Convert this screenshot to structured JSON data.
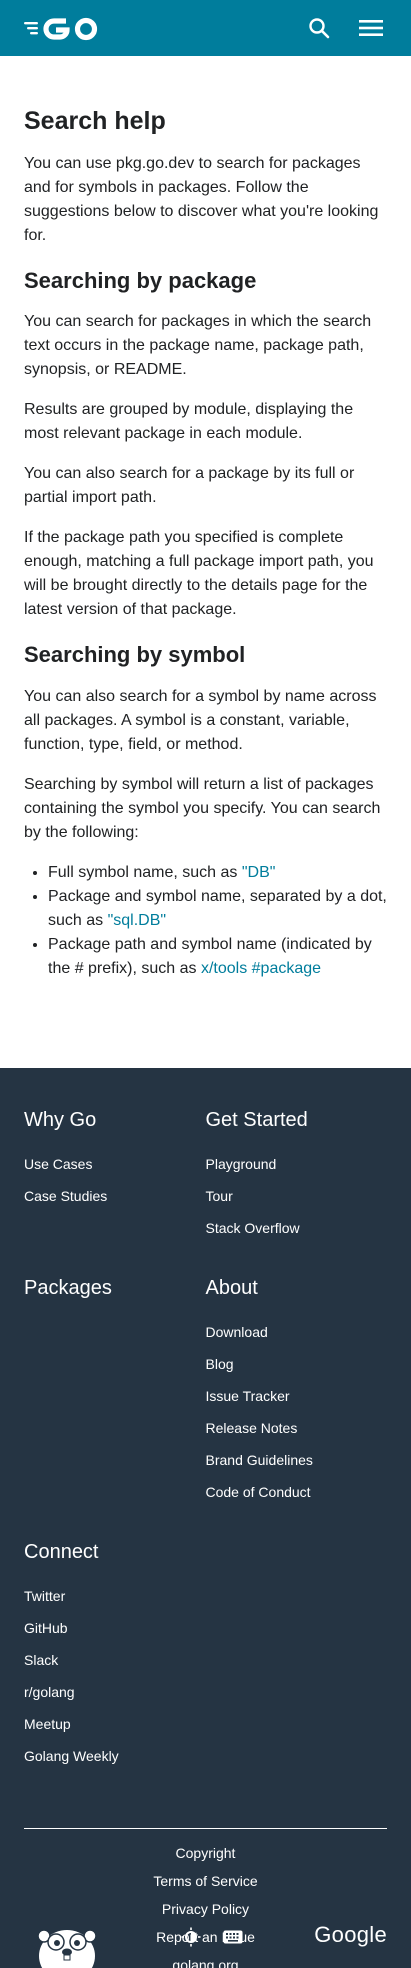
{
  "header": {
    "logo_alt": "GO",
    "icons": [
      "search-icon",
      "menu-icon"
    ]
  },
  "main": {
    "title": "Search help",
    "intro": "You can use pkg.go.dev to search for packages and for symbols in packages. Follow the suggestions below to discover what you're looking for.",
    "pkg_heading": "Searching by package",
    "pkg_p1": "You can search for packages in which the search text occurs in the package name, package path, synopsis, or README.",
    "pkg_p2": "Results are grouped by module, displaying the most relevant package in each module.",
    "pkg_p3": "You can also search for a package by its full or partial import path.",
    "pkg_p4": "If the package path you specified is complete enough, matching a full package import path, you will be brought directly to the details page for the latest version of that package.",
    "sym_heading": "Searching by symbol",
    "sym_p1": "You can also search for a symbol by name across all packages. A symbol is a constant, variable, function, type, field, or method.",
    "sym_p2": "Searching by symbol will return a list of packages containing the symbol you specify. You can search by the following:",
    "bullets": [
      {
        "text": "Full symbol name, such as ",
        "link": "\"DB\""
      },
      {
        "text": "Package and symbol name, separated by a dot, such as ",
        "link": "\"sql.DB\""
      },
      {
        "text": "Package path and symbol name (indicated by the # prefix), such as ",
        "link": "x/tools #package"
      }
    ]
  },
  "footer": {
    "why_go": {
      "title": "Why Go",
      "links": [
        "Use Cases",
        "Case Studies"
      ]
    },
    "get_started": {
      "title": "Get Started",
      "links": [
        "Playground",
        "Tour",
        "Stack Overflow"
      ]
    },
    "packages": {
      "title": "Packages",
      "links": []
    },
    "about": {
      "title": "About",
      "links": [
        "Download",
        "Blog",
        "Issue Tracker",
        "Release Notes",
        "Brand Guidelines",
        "Code of Conduct"
      ]
    },
    "connect": {
      "title": "Connect",
      "links": [
        "Twitter",
        "GitHub",
        "Slack",
        "r/golang",
        "Meetup",
        "Golang Weekly"
      ]
    },
    "bottom_links": [
      "Copyright",
      "Terms of Service",
      "Privacy Policy",
      "Report an Issue",
      "golang.org"
    ],
    "google": "Google"
  },
  "colors": {
    "header_bg": "#007d9c",
    "footer_bg": "#253443",
    "link": "#007d9c"
  }
}
